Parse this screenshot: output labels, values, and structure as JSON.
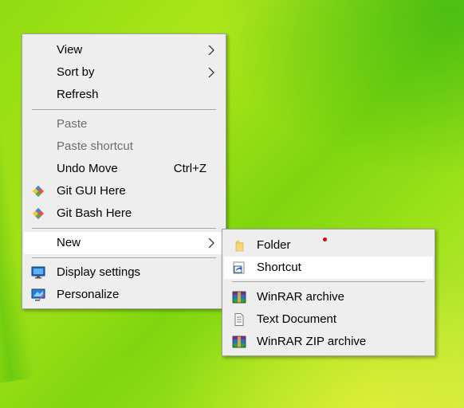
{
  "context_menu": {
    "items": [
      {
        "label": "View"
      },
      {
        "label": "Sort by"
      },
      {
        "label": "Refresh"
      },
      {
        "label": "Paste"
      },
      {
        "label": "Paste shortcut"
      },
      {
        "label": "Undo Move",
        "shortcut": "Ctrl+Z"
      },
      {
        "label": "Git GUI Here",
        "icon": "git-gui-icon"
      },
      {
        "label": "Git Bash Here",
        "icon": "git-bash-icon"
      },
      {
        "label": "New"
      },
      {
        "label": "Display settings",
        "icon": "display-settings-icon"
      },
      {
        "label": "Personalize",
        "icon": "personalize-icon"
      }
    ]
  },
  "new_submenu": {
    "items": [
      {
        "label": "Folder",
        "icon": "folder-icon"
      },
      {
        "label": "Shortcut",
        "icon": "shortcut-icon"
      },
      {
        "label": "WinRAR archive",
        "icon": "winrar-icon"
      },
      {
        "label": "Text Document",
        "icon": "text-document-icon"
      },
      {
        "label": "WinRAR ZIP archive",
        "icon": "winrar-zip-icon"
      }
    ]
  },
  "colors": {
    "menu_bg": "#eeeeee",
    "hover_bg": "#ffffff",
    "disabled_text": "#6d6d6d",
    "desktop_green": "#8fdd12"
  }
}
